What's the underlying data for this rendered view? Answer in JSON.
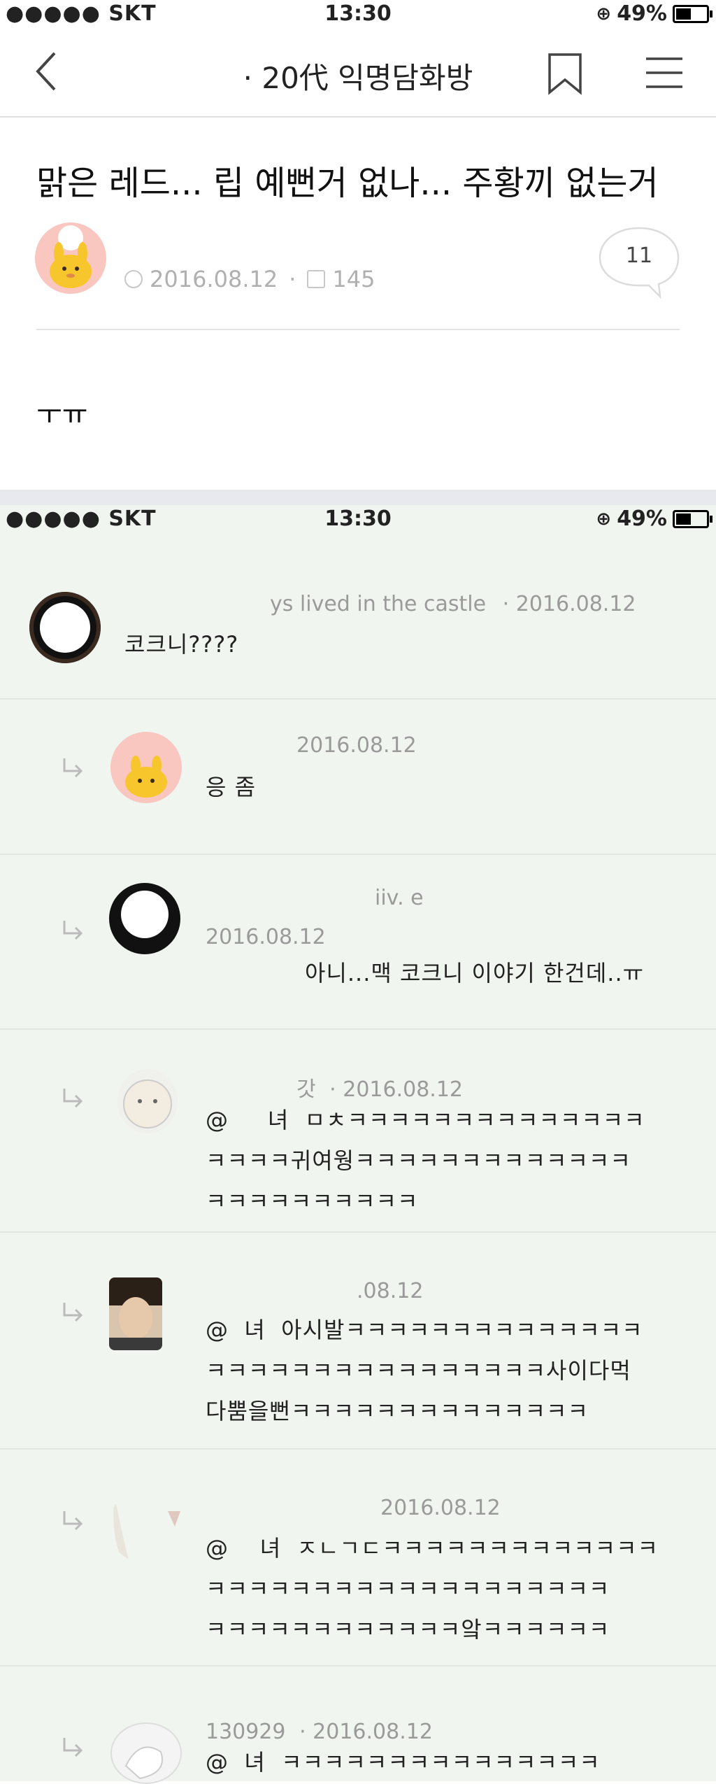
{
  "status_bar": {
    "carrier": "●●●●● SKT",
    "time": "13:30",
    "battery": "49%",
    "battery_fraction": 0.49
  },
  "nav": {
    "title": "· 20代 익명담화방",
    "back_icon": "chevron-left-icon",
    "bookmark_icon": "bookmark-icon",
    "menu_icon": "hamburger-menu-icon"
  },
  "post": {
    "title": "맑은 레드... 립 예뻔거 없나... 주황끼 없는거",
    "date": "2016.08.12",
    "views": "145",
    "comment_count": "11",
    "body": "ㅜㅠ"
  },
  "status_bar_2": {
    "carrier": "●●●●● SKT",
    "time": "13:30",
    "battery": "49%"
  },
  "comments": [
    {
      "author": "ys lived in the castle",
      "date": "· 2016.08.12",
      "text": "코크니????"
    },
    {
      "author": "",
      "date": "2016.08.12",
      "text": "응 좀"
    },
    {
      "author": "iiv.          e",
      "date": "2016.08.12",
      "text": "아니...맥 코크니 이야기 한건데..ㅠ"
    },
    {
      "author": "갓",
      "date": "· 2016.08.12",
      "text": "@     녀  ㅁㅊㅋㅋㅋㅋㅋㅋㅋㅋㅋㅋㅋㅋㅋㅋ\nㅋㅋㅋㅋ귀여웡ㅋㅋㅋㅋㅋㅋㅋㅋㅋㅋㅋㅋㅋ\nㅋㅋㅋㅋㅋㅋㅋㅋㅋㅋ"
    },
    {
      "author": "",
      "date": ".08.12",
      "text": "@  녀  아시발ㅋㅋㅋㅋㅋㅋㅋㅋㅋㅋㅋㅋㅋㅋ\nㅋㅋㅋㅋㅋㅋㅋㅋㅋㅋㅋㅋㅋㅋㅋㅋ사이다먹\n다뿜을뻔ㅋㅋㅋㅋㅋㅋㅋㅋㅋㅋㅋㅋㅋㅋ"
    },
    {
      "author": "",
      "date": "2016.08.12",
      "text": "@    녀  ㅈㄴㄱㄷㅋㅋㅋㅋㅋㅋㅋㅋㅋㅋㅋㅋㅋ\nㅋㅋㅋㅋㅋㅋㅋㅋㅋㅋㅋㅋㅋㅋㅋㅋㅋㅋㅋ\nㅋㅋㅋㅋㅋㅋㅋㅋㅋㅋㅋㅋ앜ㅋㅋㅋㅋㅋㅋ"
    },
    {
      "author": "130929",
      "date": "· 2016.08.12",
      "text": "@  녀  ㅋㅋㅋㅋㅋㅋㅋㅋㅋㅋㅋㅋㅋㅋㅋ"
    }
  ],
  "colors": {
    "thread_bg": "#f1f5ef",
    "meta_gray": "#9a9a9a",
    "avatar_pink": "#f9c6c0",
    "character_yellow": "#f7c52c"
  }
}
